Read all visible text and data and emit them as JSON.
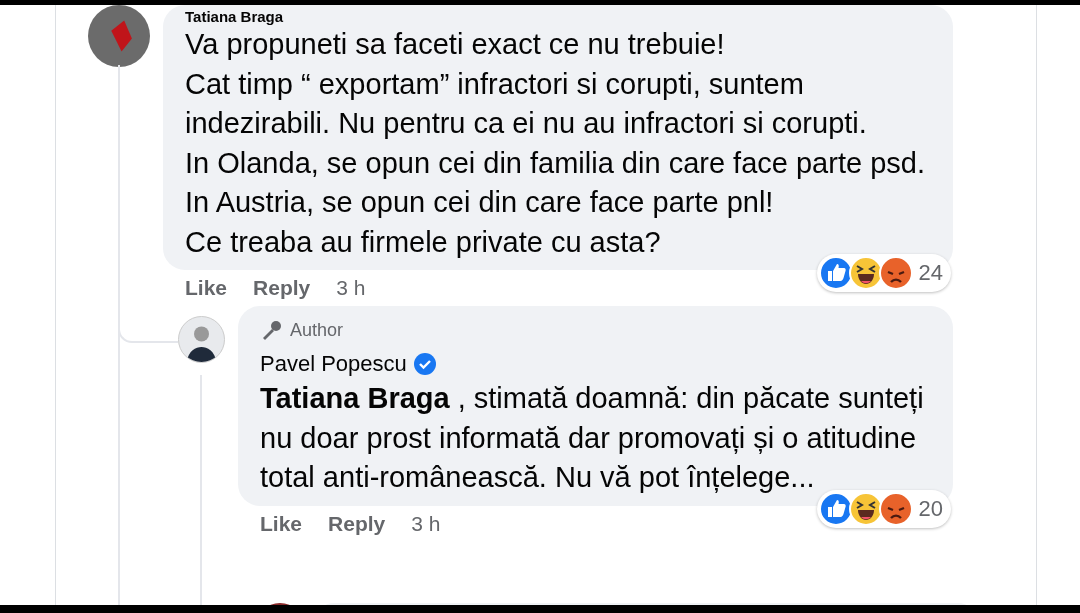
{
  "comments": [
    {
      "author": "Tatiana Braga",
      "verified": false,
      "text": "Va propuneti sa faceti exact ce nu trebuie!\nCat timp “ exportam” infractori si corupti, suntem indezirabili. Nu pentru ca ei nu au infractori si corupti.\nIn Olanda, se opun cei din familia din care face parte psd.\nIn Austria, se opun cei din care face parte pnl!\nCe treaba au firmele private cu asta?",
      "actions": [
        "Like",
        "Reply"
      ],
      "time": "3 h",
      "reactions": [
        {
          "kind": "like"
        },
        {
          "kind": "haha"
        },
        {
          "kind": "angry"
        }
      ],
      "reaction_count": "24",
      "reply": false
    },
    {
      "author": "Pavel Popescu",
      "author_badge": "Author",
      "verified": true,
      "text": "**Tatiana Braga** , stimată doamnă: din păcate sunteți nu doar prost informată dar promovați și o atitudine total anti-românească. Nu vă pot înțelege...",
      "actions": [
        "Like",
        "Reply"
      ],
      "time": "3 h",
      "reactions": [
        {
          "kind": "like"
        },
        {
          "kind": "haha"
        },
        {
          "kind": "angry"
        }
      ],
      "reaction_count": "20",
      "reply": true
    }
  ]
}
